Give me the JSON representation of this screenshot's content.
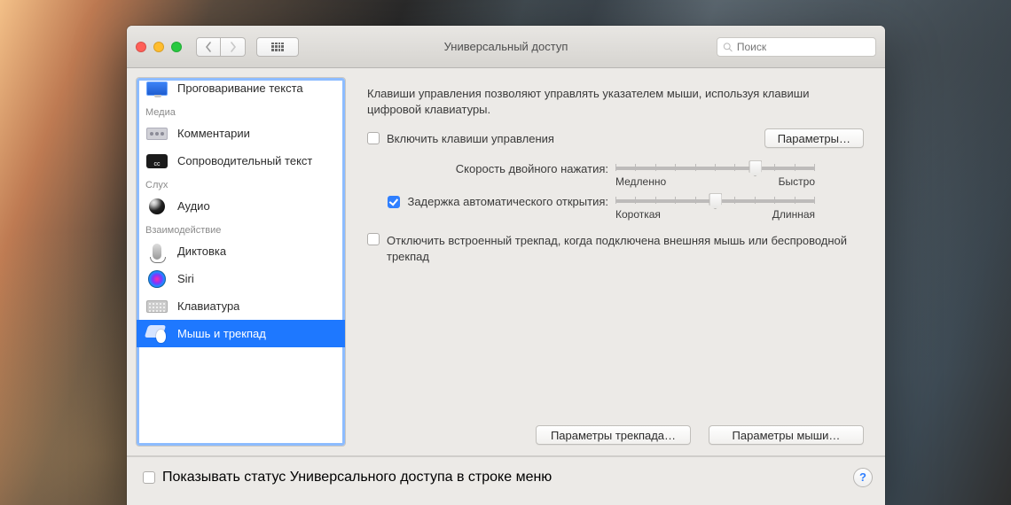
{
  "window": {
    "title": "Универсальный доступ"
  },
  "search": {
    "placeholder": "Поиск"
  },
  "sidebar": {
    "groups": {
      "media": "Медиа",
      "hearing": "Слух",
      "interaction": "Взаимодействие"
    },
    "items": {
      "speech": "Проговаривание текста",
      "comments": "Комментарии",
      "captions": "Сопроводительный текст",
      "audio": "Аудио",
      "dictation": "Диктовка",
      "siri": "Siri",
      "keyboard": "Клавиатура",
      "mouse": "Мышь и трекпад"
    }
  },
  "pane": {
    "desc": "Клавиши управления позволяют управлять указателем мыши, используя клавиши цифровой клавиатуры.",
    "enable_mouse_keys": "Включить клавиши управления",
    "options_btn": "Параметры…",
    "slider1": {
      "label": "Скорость двойного нажатия:",
      "min": "Медленно",
      "max": "Быстро"
    },
    "slider2": {
      "label": "Задержка автоматического открытия:",
      "min": "Короткая",
      "max": "Длинная"
    },
    "disable_trackpad": "Отключить встроенный трекпад, когда подключена внешняя мышь или беспроводной трекпад",
    "trackpad_btn": "Параметры трекпада…",
    "mouse_btn": "Параметры мыши…"
  },
  "footer": {
    "show_in_menu": "Показывать статус Универсального доступа в строке меню"
  }
}
